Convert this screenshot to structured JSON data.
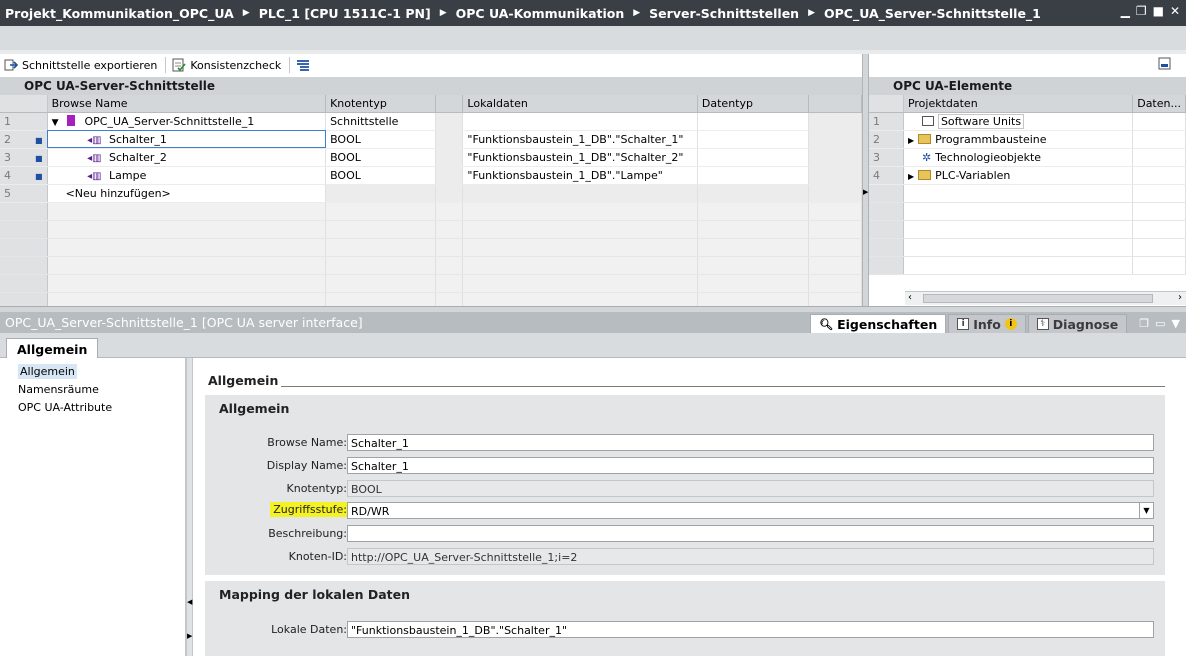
{
  "titlebar": {
    "crumbs": [
      "Projekt_Kommunikation_OPC_UA",
      "PLC_1 [CPU 1511C-1 PN]",
      "OPC UA-Kommunikation",
      "Server-Schnittstellen",
      "OPC_UA_Server-Schnittstelle_1"
    ]
  },
  "toolbar": {
    "export_label": "Schnittstelle exportieren",
    "check_label": "Konsistenzcheck"
  },
  "left_panel": {
    "title": "OPC UA-Server-Schnittstelle",
    "columns": [
      "Browse Name",
      "Knotentyp",
      "",
      "Lokaldaten",
      "Datentyp"
    ],
    "rows": [
      {
        "num": "1",
        "name": "OPC_UA_Server-Schnittstelle_1",
        "type": "Schnittstelle",
        "local": "",
        "dtype": ""
      },
      {
        "num": "2",
        "name": "Schalter_1",
        "type": "BOOL",
        "local": "\"Funktionsbaustein_1_DB\".\"Schalter_1\"",
        "dtype": ""
      },
      {
        "num": "3",
        "name": "Schalter_2",
        "type": "BOOL",
        "local": "\"Funktionsbaustein_1_DB\".\"Schalter_2\"",
        "dtype": ""
      },
      {
        "num": "4",
        "name": "Lampe",
        "type": "BOOL",
        "local": "\"Funktionsbaustein_1_DB\".\"Lampe\"",
        "dtype": ""
      },
      {
        "num": "5",
        "name": "<Neu hinzufügen>",
        "type": "",
        "local": "",
        "dtype": ""
      }
    ]
  },
  "right_panel": {
    "title": "OPC UA-Elemente",
    "columns": [
      "Projektdaten",
      "Daten..."
    ],
    "rows": [
      {
        "num": "1",
        "label": "Software Units"
      },
      {
        "num": "2",
        "label": "Programmbausteine"
      },
      {
        "num": "3",
        "label": "Technologieobjekte"
      },
      {
        "num": "4",
        "label": "PLC-Variablen"
      }
    ]
  },
  "inspector": {
    "title": "OPC_UA_Server-Schnittstelle_1 [OPC UA server interface]",
    "tabs": {
      "properties": "Eigenschaften",
      "info": "Info",
      "diagnose": "Diagnose"
    },
    "subtab": "Allgemein",
    "nav": [
      "Allgemein",
      "Namensräume",
      "OPC UA-Attribute"
    ],
    "section_title": "Allgemein",
    "group1_title": "Allgemein",
    "fields": {
      "browse_name_label": "Browse Name:",
      "browse_name": "Schalter_1",
      "display_name_label": "Display Name:",
      "display_name": "Schalter_1",
      "knotentyp_label": "Knotentyp:",
      "knotentyp": "BOOL",
      "zugriff_label": "Zugriffsstufe:",
      "zugriff": "RD/WR",
      "beschreibung_label": "Beschreibung:",
      "beschreibung": "",
      "knoten_id_label": "Knoten-ID:",
      "knoten_id": "http://OPC_UA_Server-Schnittstelle_1;i=2"
    },
    "group2_title": "Mapping der lokalen Daten",
    "lokal_label": "Lokale Daten:",
    "lokal_value": "\"Funktionsbaustein_1_DB\".\"Schalter_1\""
  }
}
